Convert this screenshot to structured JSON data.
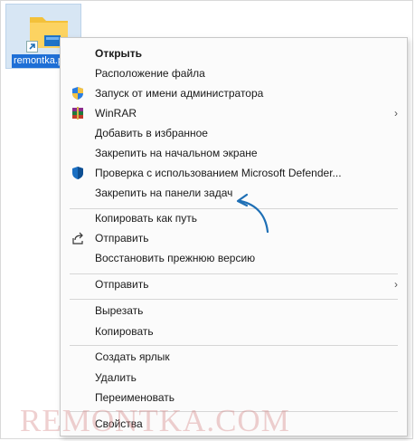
{
  "desktop": {
    "shortcut_label": "remontka.p"
  },
  "menu": {
    "open": "Открыть",
    "file_location": "Расположение файла",
    "run_as_admin": "Запуск от имени администратора",
    "winrar": "WinRAR",
    "add_favorites": "Добавить в избранное",
    "pin_start": "Закрепить на начальном экране",
    "defender_scan": "Проверка с использованием Microsoft Defender...",
    "pin_taskbar": "Закрепить на панели задач",
    "copy_path": "Копировать как путь",
    "share": "Отправить",
    "restore_prev": "Восстановить прежнюю версию",
    "send_to": "Отправить",
    "cut": "Вырезать",
    "copy": "Копировать",
    "create_shortcut": "Создать ярлык",
    "delete": "Удалить",
    "rename": "Переименовать",
    "properties": "Свойства",
    "submenu_arrow": "›"
  },
  "watermark": "REMONTKA.COM",
  "colors": {
    "arrow": "#1e6fb5",
    "selection": "#1e6fd6",
    "watermark": "#d27878"
  }
}
